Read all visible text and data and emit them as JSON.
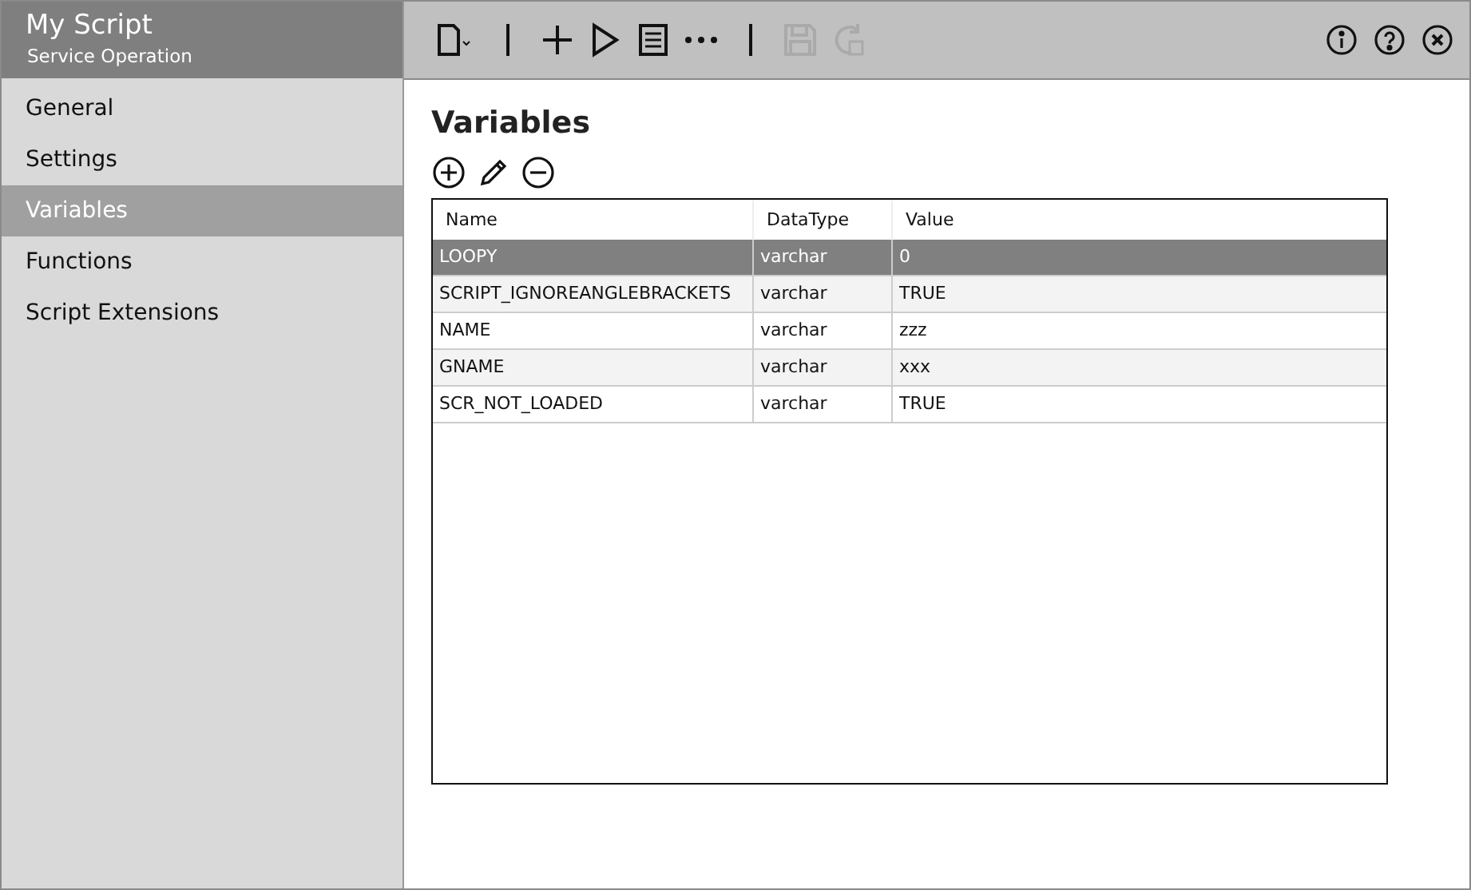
{
  "header": {
    "title": "My Script",
    "subtitle": "Service Operation"
  },
  "sidebar": {
    "items": [
      {
        "label": "General",
        "selected": false
      },
      {
        "label": "Settings",
        "selected": false
      },
      {
        "label": "Variables",
        "selected": true
      },
      {
        "label": "Functions",
        "selected": false
      },
      {
        "label": "Script Extensions",
        "selected": false
      }
    ]
  },
  "toolbar": [
    {
      "kind": "new",
      "disabled": false
    },
    {
      "kind": "separator"
    },
    {
      "kind": "add",
      "disabled": false
    },
    {
      "kind": "run",
      "disabled": false
    },
    {
      "kind": "list",
      "disabled": false
    },
    {
      "kind": "more",
      "disabled": false
    },
    {
      "kind": "separator"
    },
    {
      "kind": "save",
      "disabled": true
    },
    {
      "kind": "refresh",
      "disabled": true
    }
  ],
  "window_buttons": [
    {
      "kind": "info"
    },
    {
      "kind": "help"
    },
    {
      "kind": "close"
    }
  ],
  "page": {
    "title": "Variables",
    "actions": [
      {
        "kind": "add"
      },
      {
        "kind": "edit"
      },
      {
        "kind": "remove"
      }
    ]
  },
  "table": {
    "columns": [
      "Name",
      "DataType",
      "Value"
    ],
    "rows": [
      {
        "cells": [
          "LOOPY",
          "varchar",
          "0"
        ],
        "selected": true
      },
      {
        "cells": [
          "SCRIPT_IGNOREANGLEBRACKETS",
          "varchar",
          "TRUE"
        ],
        "selected": false
      },
      {
        "cells": [
          "NAME",
          "varchar",
          "zzz"
        ],
        "selected": false
      },
      {
        "cells": [
          "GNAME",
          "varchar",
          "xxx"
        ],
        "selected": false
      },
      {
        "cells": [
          "SCR_NOT_LOADED",
          "varchar",
          "TRUE"
        ],
        "selected": false
      }
    ]
  }
}
